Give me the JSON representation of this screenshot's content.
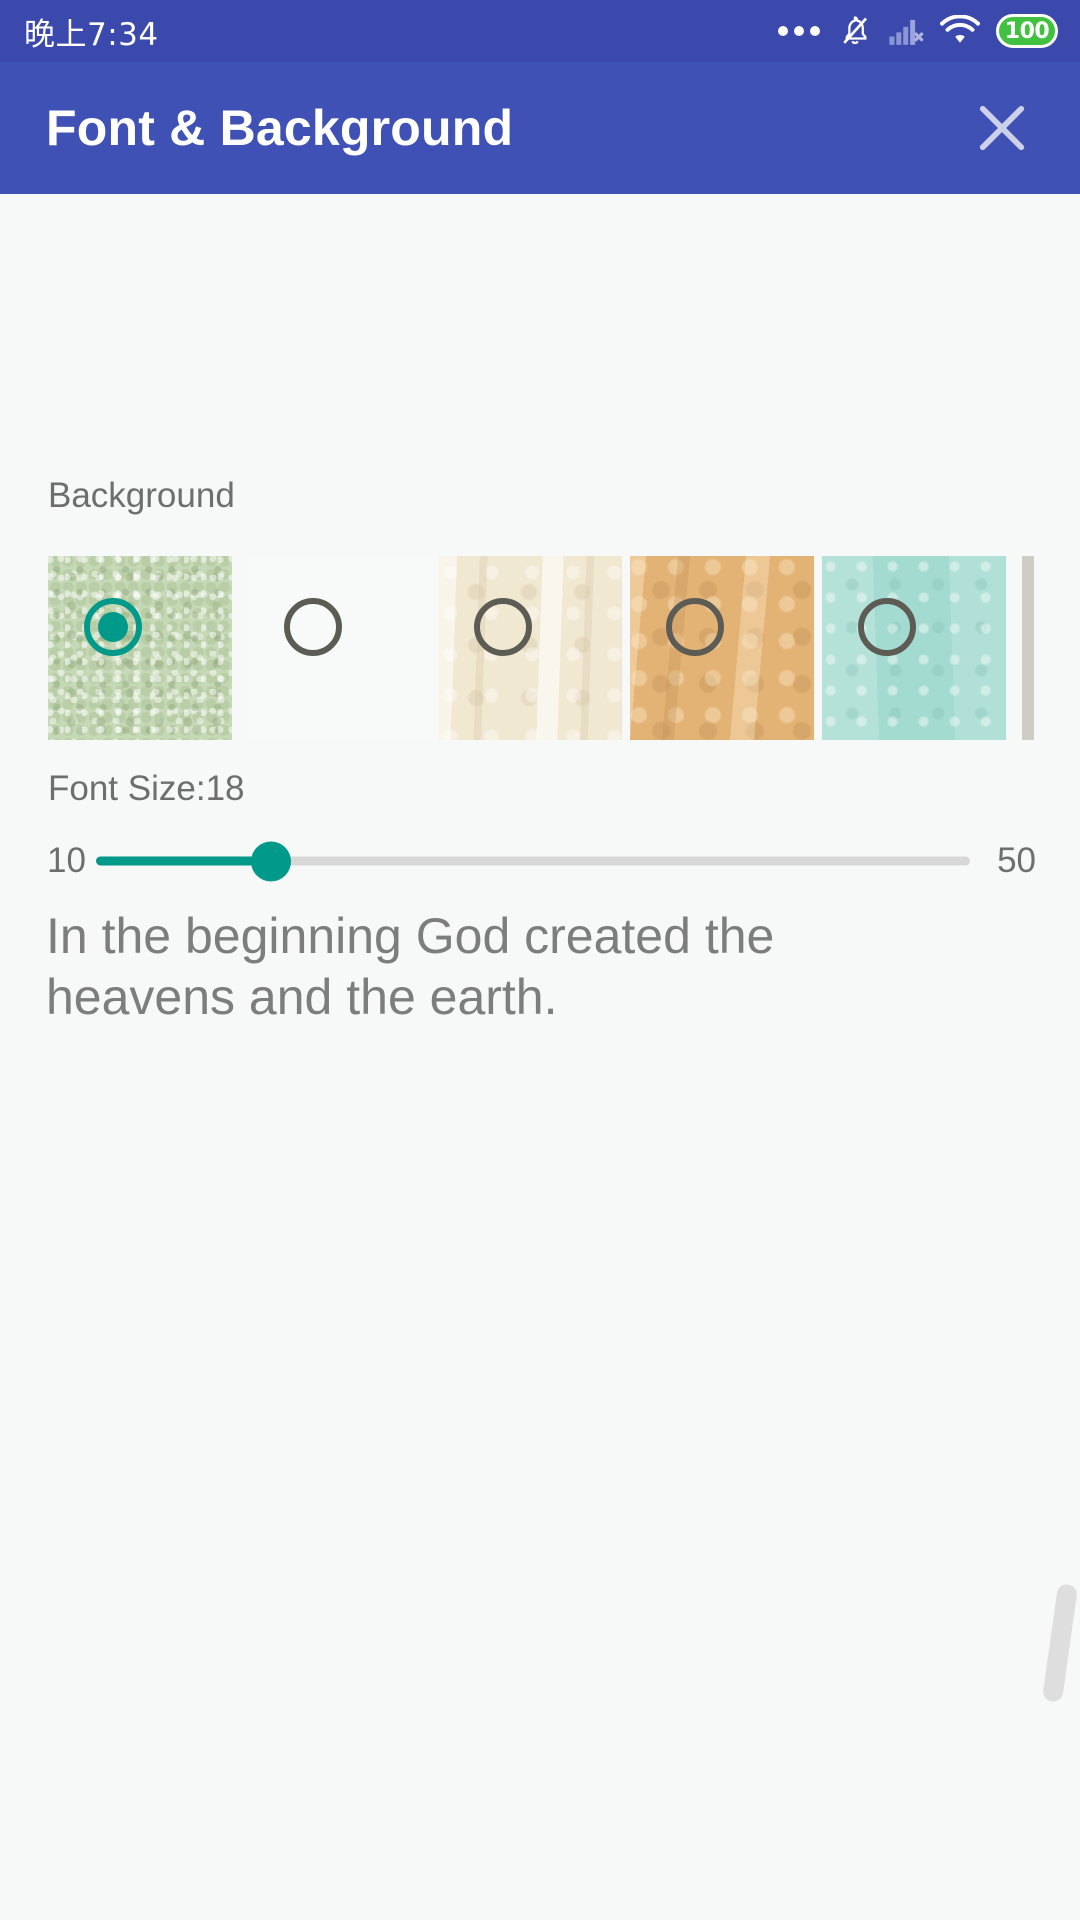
{
  "status_bar": {
    "time": "晚上7:34",
    "background_color": "#3a49ab",
    "icons": [
      {
        "name": "more-dots-icon",
        "label": "more"
      },
      {
        "name": "notifications-off-icon",
        "label": "notifications off"
      },
      {
        "name": "signal-no-sim-icon",
        "label": "no sim"
      },
      {
        "name": "wifi-icon",
        "label": "wifi"
      },
      {
        "name": "battery-icon",
        "label": "battery"
      }
    ],
    "battery_level": "100"
  },
  "app_bar": {
    "title": "Font & Background",
    "close_label": "×",
    "background_color": "#3f51b5",
    "title_color": "#ffffff"
  },
  "background_section": {
    "label": "Background",
    "selected_index": 0,
    "accent_color": "#00998a",
    "swatches": [
      {
        "name": "swatch-green-texture",
        "color": "#c6d9b6",
        "selected": true
      },
      {
        "name": "swatch-white",
        "color": "#f8f9f9",
        "selected": false
      },
      {
        "name": "swatch-cream-parchment",
        "color": "#f1e8d2",
        "selected": false
      },
      {
        "name": "swatch-tan-kraft",
        "color": "#e3b376",
        "selected": false
      },
      {
        "name": "swatch-mint",
        "color": "#a3dbd0",
        "selected": false
      },
      {
        "name": "swatch-partial-edge",
        "color": "#cfcdc3",
        "selected": false
      }
    ]
  },
  "font_size_section": {
    "label": "Font Size:18",
    "value": 18,
    "min_label": "10",
    "max_label": "50",
    "min": 10,
    "max": 50,
    "fill_color": "#00998a",
    "track_color": "#d7d7d7"
  },
  "preview": {
    "text": "In the beginning God created the heavens and the earth.",
    "color": "#7d7d7d"
  },
  "colors": {
    "page_background": "#f7f8f8",
    "label_text": "#6e6e6e",
    "accent": "#00998a",
    "primary": "#3f51b5"
  }
}
